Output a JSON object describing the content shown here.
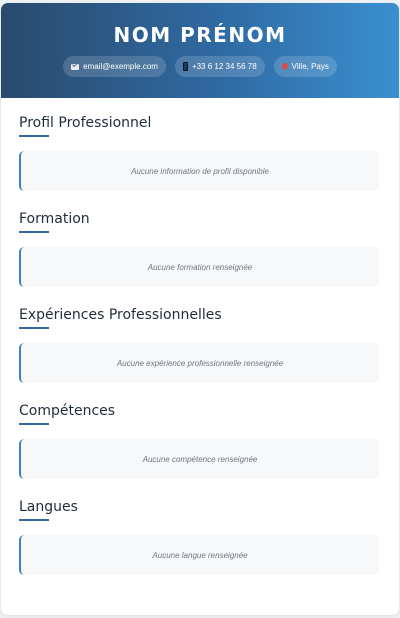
{
  "header": {
    "name": "NOM PRÉNOM",
    "email": "email@exemple.com",
    "phone": "+33 6 12 34 56 78",
    "location": "Ville, Pays",
    "icons": {
      "email": "envelope-icon",
      "phone": "phone-icon",
      "location": "location-pin-icon"
    }
  },
  "sections": [
    {
      "title": "Profil Professionnel",
      "empty_text": "Aucune information de profil disponible"
    },
    {
      "title": "Formation",
      "empty_text": "Aucune formation renseignée"
    },
    {
      "title": "Expériences Professionnelles",
      "empty_text": "Aucune expérience professionnelle renseignée"
    },
    {
      "title": "Compétences",
      "empty_text": "Aucune compétence renseignée"
    },
    {
      "title": "Langues",
      "empty_text": "Aucune langue renseignée"
    }
  ],
  "colors": {
    "header_gradient_start": "#2a4a6d",
    "header_gradient_end": "#3a8fd0",
    "accent": "#2f6aa3",
    "box_border": "#3b82c4"
  }
}
